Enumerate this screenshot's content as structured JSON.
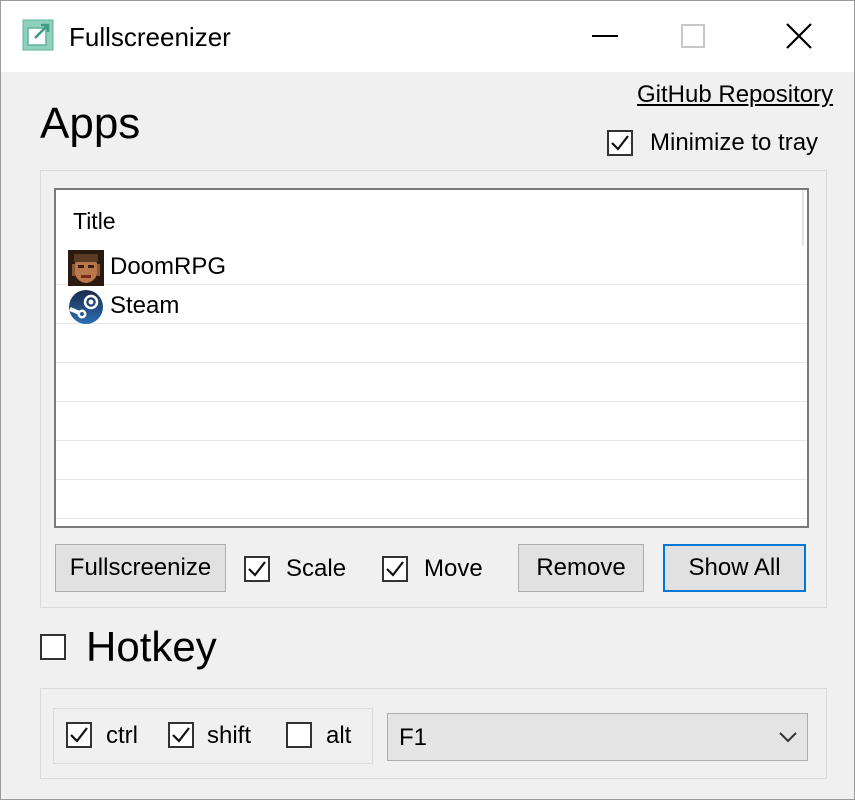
{
  "window": {
    "title": "Fullscreenizer",
    "icon": "fullscreenizer-app-icon",
    "controls": [
      "minimize-icon",
      "maximize-icon",
      "close-icon"
    ]
  },
  "header": {
    "github_link": "GitHub Repository",
    "apps_heading": "Apps",
    "minimize_to_tray": {
      "label": "Minimize to tray",
      "checked": true
    }
  },
  "apps_list": {
    "column_header": "Title",
    "rows": [
      {
        "title": "DoomRPG",
        "icon": "doomrpg-app-icon"
      },
      {
        "title": "Steam",
        "icon": "steam-app-icon"
      }
    ]
  },
  "actions": {
    "fullscreenize_label": "Fullscreenize",
    "scale": {
      "label": "Scale",
      "checked": true
    },
    "move": {
      "label": "Move",
      "checked": true
    },
    "remove_label": "Remove",
    "show_all_label": "Show All"
  },
  "hotkey": {
    "heading": "Hotkey",
    "enabled": false,
    "ctrl": {
      "label": "ctrl",
      "checked": true
    },
    "shift": {
      "label": "shift",
      "checked": true
    },
    "alt": {
      "label": "alt",
      "checked": false
    },
    "key_value": "F1"
  },
  "colors": {
    "accent": "#0078d7",
    "window_bg": "#f0f0f0",
    "button_bg": "#e1e1e1"
  }
}
